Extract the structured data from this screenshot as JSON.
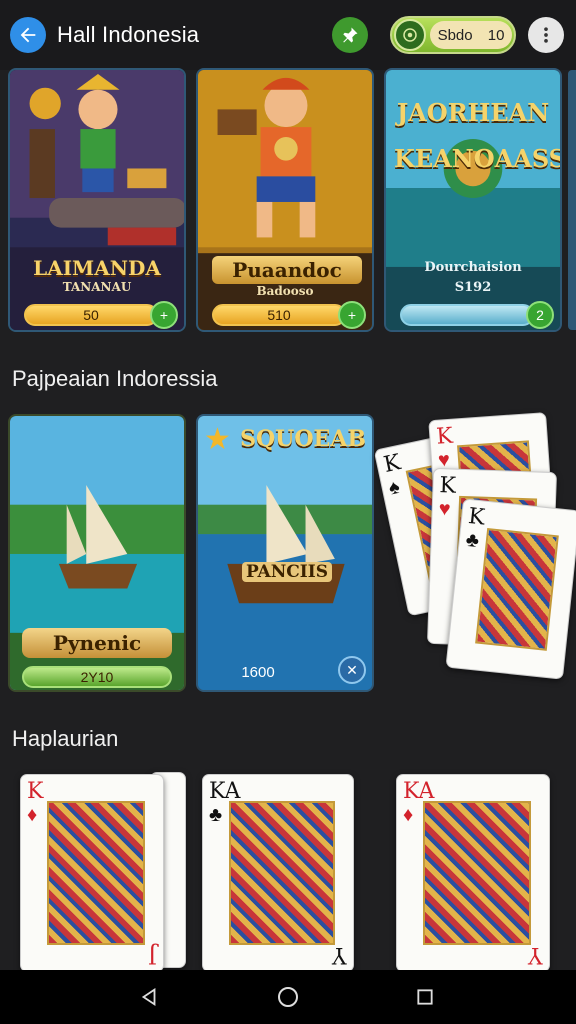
{
  "header": {
    "title": "Hall Indonesia",
    "balance_label": "Sbdo",
    "balance_value": "10",
    "icons": [
      "back-arrow-icon",
      "pin-icon",
      "coin-icon",
      "more-vertical-icon"
    ]
  },
  "featured_games": [
    {
      "name": "LAIMANDA",
      "subtitle": "TANANAU",
      "pill_value": "50",
      "button_symbol": "+"
    },
    {
      "name": "Puaandoc",
      "subtitle": "Badooso",
      "pill_value": "510",
      "button_symbol": "+"
    },
    {
      "title_art": "JAORHEAN KEANOAASS",
      "name": "Dourchaision",
      "subtitle": "S192",
      "button_symbol": "2"
    }
  ],
  "section_1": {
    "title": "Pajpeaian Indoressia",
    "games": [
      {
        "name": "Pynenic",
        "pill_value": "2Y10"
      },
      {
        "title_art": "SQUOEAB",
        "ship_banner": "PANCIIS",
        "value": "1600",
        "button_symbol": "✕"
      },
      {
        "name": "Card fan",
        "cards": [
          "K",
          "K",
          "K",
          "K"
        ]
      }
    ]
  },
  "section_2": {
    "title": "Haplaurian",
    "cards": [
      {
        "rank": "K",
        "bottom_rank": "J",
        "color": "red"
      },
      {
        "rank": "KA",
        "bottom_rank": "Y",
        "color": "black"
      },
      {
        "rank": "KA",
        "bottom_rank": "Y",
        "color": "red"
      }
    ]
  },
  "navbar": {
    "icons": [
      "back-triangle-icon",
      "home-circle-icon",
      "recent-square-icon"
    ]
  },
  "colors": {
    "accent_blue": "#2f8fe8",
    "accent_green": "#3f9a2e",
    "pill_gold": "#f1c24e",
    "background": "#1f1f21"
  }
}
